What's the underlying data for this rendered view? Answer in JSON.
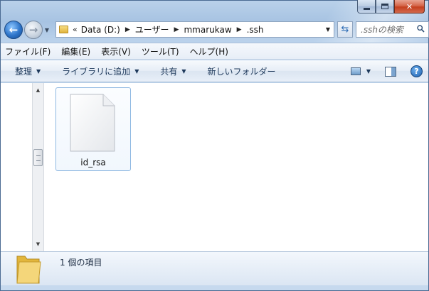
{
  "window": {
    "caption_buttons": {
      "minimize": "minimize",
      "maximize": "maximize",
      "close": "close"
    }
  },
  "nav": {
    "back": "back",
    "forward": "forward"
  },
  "address": {
    "overflow": "«",
    "crumbs": [
      "Data (D:)",
      "ユーザー",
      "mmarukaw",
      ".ssh"
    ]
  },
  "search": {
    "placeholder": ".sshの検索"
  },
  "menubar": {
    "items": [
      "ファイル(F)",
      "編集(E)",
      "表示(V)",
      "ツール(T)",
      "ヘルプ(H)"
    ]
  },
  "cmdbar": {
    "organize": "整理",
    "add_to_library": "ライブラリに追加",
    "share": "共有",
    "new_folder": "新しいフォルダー",
    "help": "?"
  },
  "files": [
    {
      "name": "id_rsa",
      "type": "document"
    }
  ],
  "details": {
    "count": "1 個の項目"
  },
  "colors": {
    "frame": "#b9d1ea",
    "command_text": "#1e395b",
    "selection_border": "#8eb8e2",
    "close_button": "#c5401f"
  }
}
